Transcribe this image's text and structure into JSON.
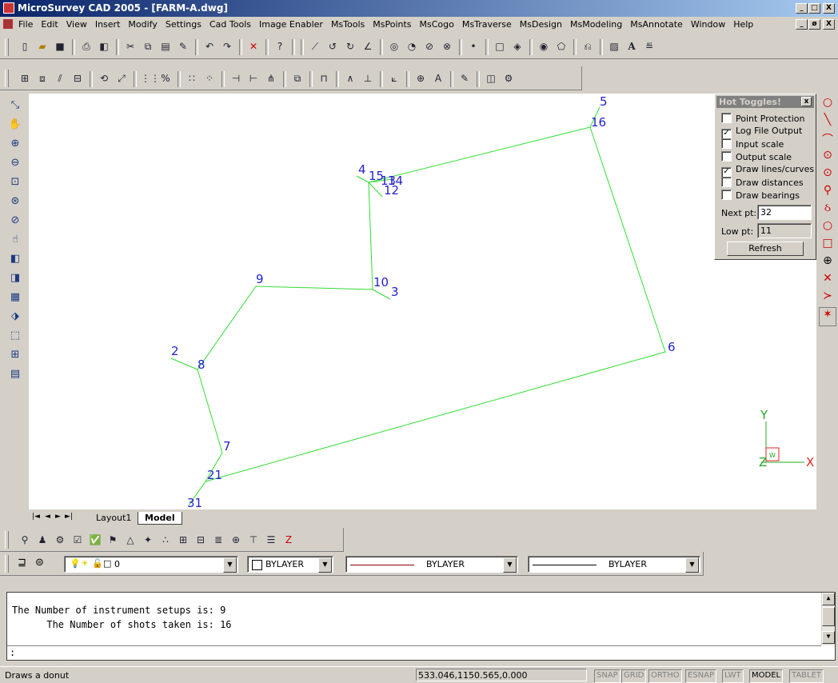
{
  "window": {
    "title": "MicroSurvey CAD 2005 - [FARM-A.dwg]",
    "controls": [
      "_",
      "□",
      "X"
    ],
    "doc_controls": [
      "_",
      "ø",
      "X"
    ]
  },
  "menu": [
    "File",
    "Edit",
    "View",
    "Insert",
    "Modify",
    "Settings",
    "Cad Tools",
    "Image Enabler",
    "MsTools",
    "MsPoints",
    "MsCogo",
    "MsTraverse",
    "MsDesign",
    "MsModeling",
    "MsAnnotate",
    "Window",
    "Help"
  ],
  "drawing": {
    "point_labels": [
      "5",
      "16",
      "4",
      "15",
      "14",
      "13",
      "12",
      "10",
      "3",
      "9",
      "2",
      "8",
      "6",
      "7",
      "21",
      "31"
    ],
    "ucs": {
      "y": "Y",
      "x": "X",
      "z": "Z",
      "w": "W"
    }
  },
  "hot_toggles": {
    "title": "Hot Toggles!",
    "close": "x",
    "options": [
      {
        "label": "Point Protection",
        "checked": false
      },
      {
        "label": "Log File Output",
        "checked": true
      },
      {
        "label": "Input scale",
        "checked": false
      },
      {
        "label": "Output scale",
        "checked": false
      },
      {
        "label": "Draw lines/curves",
        "checked": true
      },
      {
        "label": "Draw distances",
        "checked": false
      },
      {
        "label": "Draw bearings",
        "checked": false
      }
    ],
    "next_pt_label": "Next pt:",
    "next_pt_value": "32",
    "low_pt_label": "Low pt:",
    "low_pt_value": "11",
    "refresh_label": "Refresh"
  },
  "layout_tabs": {
    "nav": [
      "|◄",
      "◄",
      "►",
      "►|"
    ],
    "tabs": [
      "Layout1",
      "Model"
    ],
    "active": "Model"
  },
  "properties": {
    "layer": "0",
    "color": "BYLAYER",
    "linetype": "BYLAYER",
    "lineweight": "BYLAYER"
  },
  "command": {
    "line1": "The Number of instrument setups is: 9",
    "line2": "      The Number of shots taken is: 16",
    "prompt": ":"
  },
  "status": {
    "message": "Draws a donut",
    "coords": "533.046,1150.565,0.000",
    "toggles": [
      "SNAP",
      "GRID",
      "ORTHO",
      "ESNAP",
      "LWT",
      "MODEL",
      "TABLET"
    ],
    "active_toggle": "MODEL"
  },
  "colors": {
    "lines": "#33dd33",
    "labels": "#2222cc",
    "ucs": "#22aa22",
    "ucs_x": "#ee2222"
  }
}
